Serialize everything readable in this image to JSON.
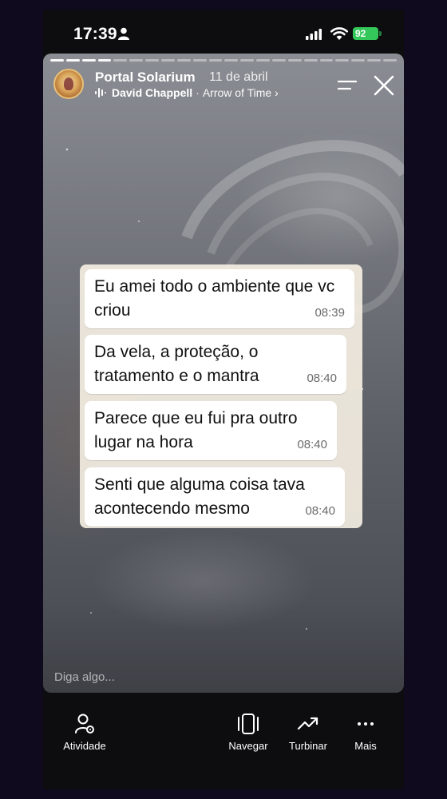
{
  "statusbar": {
    "time": "17:39",
    "battery": "92",
    "icons": [
      "person-icon",
      "signal-icon",
      "wifi-icon",
      "battery-icon"
    ]
  },
  "story": {
    "progress": {
      "segments": 22,
      "completed": 4
    },
    "account": {
      "name": "Portal Solarium",
      "date": "11 de abril"
    },
    "music": {
      "artist": "David Chappell",
      "separator": "·",
      "track": "Arrow of Time",
      "chevron": "›"
    },
    "chat": [
      {
        "text": "Eu amei todo o ambiente que vc criou",
        "time": "08:39"
      },
      {
        "text": "Da vela, a proteção, o tratamento e o mantra",
        "time": "08:40"
      },
      {
        "text": "Parece que eu fui pra outro lugar na hora",
        "time": "08:40"
      },
      {
        "text": "Senti que alguma coisa tava acontecendo mesmo",
        "time": "08:40"
      }
    ],
    "reply_placeholder": "Diga algo..."
  },
  "bottom_nav": {
    "activity": "Atividade",
    "navigate": "Navegar",
    "boost": "Turbinar",
    "more": "Mais"
  },
  "colors": {
    "page_bg": "#0f0a1e",
    "battery": "#34c759",
    "chat_bg": "#f4eee2"
  }
}
